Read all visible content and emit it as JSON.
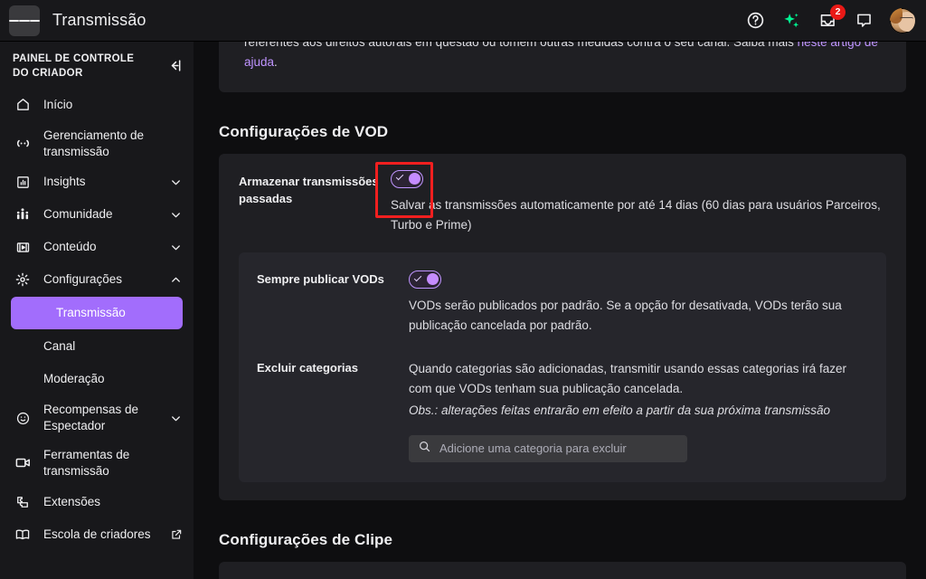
{
  "topbar": {
    "menu_icon": "hamburger-icon",
    "title": "Transmissão",
    "icons": [
      {
        "name": "help-icon",
        "label": "?"
      },
      {
        "name": "sparkle-icon",
        "label": ""
      },
      {
        "name": "inbox-icon",
        "label": "",
        "badge": "2"
      },
      {
        "name": "chat-icon",
        "label": ""
      }
    ],
    "avatar_name": "user-avatar"
  },
  "sidebar": {
    "header_title": "PAINEL DE CONTROLE DO CRIADOR",
    "collapse_icon": "collapse-sidebar-icon",
    "items": [
      {
        "label": "Início",
        "icon": "home-icon",
        "chevron": "",
        "sub": false
      },
      {
        "label": "Gerenciamento de transmissão",
        "icon": "broadcast-icon",
        "chevron": "",
        "sub": false
      },
      {
        "label": "Insights",
        "icon": "chart-icon",
        "chevron": "down",
        "sub": false
      },
      {
        "label": "Comunidade",
        "icon": "community-icon",
        "chevron": "down",
        "sub": false
      },
      {
        "label": "Conteúdo",
        "icon": "content-icon",
        "chevron": "down",
        "sub": false
      },
      {
        "label": "Configurações",
        "icon": "gear-icon",
        "chevron": "up",
        "sub": false
      },
      {
        "label": "Transmissão",
        "icon": "",
        "chevron": "",
        "sub": true,
        "active": true
      },
      {
        "label": "Canal",
        "icon": "",
        "chevron": "",
        "sub": true
      },
      {
        "label": "Moderação",
        "icon": "",
        "chevron": "",
        "sub": true
      },
      {
        "label": "Recompensas de Espectador",
        "icon": "rewards-icon",
        "chevron": "down",
        "sub": false
      },
      {
        "label": "Ferramentas de transmissão",
        "icon": "camera-icon",
        "chevron": "",
        "sub": false
      },
      {
        "label": "Extensões",
        "icon": "extensions-icon",
        "chevron": "",
        "sub": false
      },
      {
        "label": "Escola de criadores",
        "icon": "book-icon",
        "chevron": "",
        "sub": false,
        "external": true
      }
    ]
  },
  "main": {
    "top_card": {
      "paragraph_part1": "referentes aos direitos autorais em questão ou tomem outras medidas contra o seu canal. Saiba mais ",
      "link_text": "neste artigo de ajuda",
      "paragraph_end": "."
    },
    "vod_section_title": "Configurações de VOD",
    "store_past": {
      "label": "Armazenar transmissões passadas",
      "toggle_state": "on",
      "description": "Salvar as transmissões automaticamente por até 14 dias (60 dias para usuários Parceiros, Turbo e Prime)"
    },
    "always_publish": {
      "label": "Sempre publicar VODs",
      "toggle_state": "on",
      "description": "VODs serão publicados por padrão. Se a opção for desativada, VODs terão sua publicação cancelada por padrão."
    },
    "exclude_categories": {
      "label": "Excluir categorias",
      "description": "Quando categorias são adicionadas, transmitir usando essas categorias irá fazer com que VODs tenham sua publicação cancelada.",
      "note": "Obs.: alterações feitas entrarão em efeito a partir da sua próxima transmissão",
      "search_placeholder": "Adicione uma categoria para excluir",
      "search_icon": "search-icon"
    },
    "clip_section_title": "Configurações de Clipe"
  },
  "annotation": {
    "highlight_color": "#f21f1f",
    "target": "store-past-broadcasts-toggle"
  },
  "colors": {
    "accent_purple": "#a26dfc",
    "link_purple": "#bf94ff",
    "page_bg": "#0e0e10",
    "panel_bg": "#1f1f23",
    "inner_panel_bg": "#26262c"
  }
}
